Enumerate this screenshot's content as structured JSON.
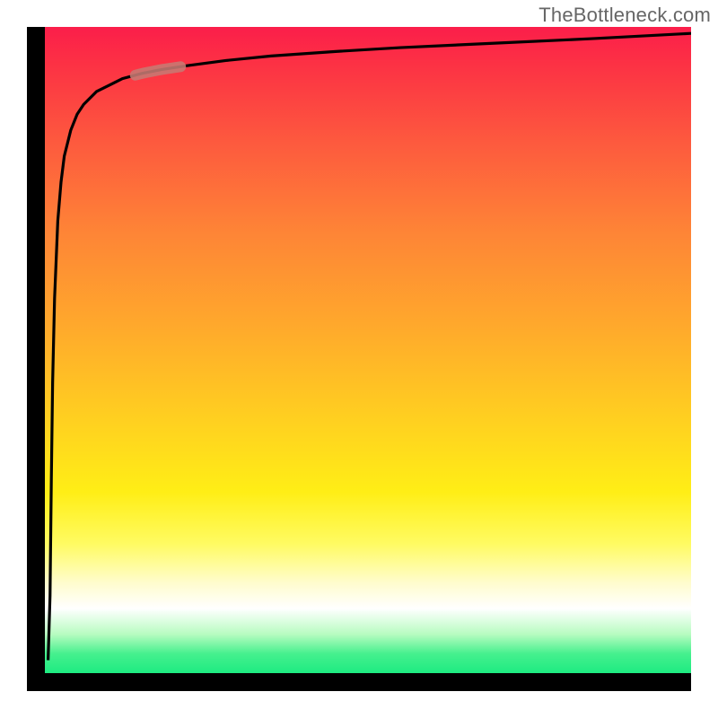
{
  "watermark_text": "TheBottleneck.com",
  "colors": {
    "curve": "#000000",
    "highlight": "#c67a73",
    "frame": "#000000",
    "watermark": "#666666"
  },
  "chart_data": {
    "type": "line",
    "title": "",
    "xlabel": "",
    "ylabel": "",
    "xlim": [
      0,
      100
    ],
    "ylim": [
      0,
      100
    ],
    "grid": false,
    "legend": false,
    "series": [
      {
        "name": "bottleneck-curve",
        "x": [
          0.5,
          0.8,
          1.0,
          1.2,
          1.5,
          2.0,
          2.5,
          3.0,
          4.0,
          5.0,
          6.0,
          8.0,
          10,
          12,
          15,
          18,
          22,
          28,
          35,
          45,
          55,
          70,
          85,
          100
        ],
        "y": [
          2,
          12,
          30,
          45,
          58,
          70,
          76,
          80,
          84,
          86.5,
          88,
          90,
          91,
          92,
          92.8,
          93.4,
          94,
          94.8,
          95.5,
          96.2,
          96.8,
          97.5,
          98.2,
          99
        ]
      }
    ],
    "highlight_segment": {
      "x_start": 14,
      "x_end": 21,
      "note": "short pink-red segment on the upper-left curve knee"
    },
    "background_gradient": {
      "direction": "vertical",
      "stops": [
        {
          "pos": 0.0,
          "color": "#fb1e4a"
        },
        {
          "pos": 0.18,
          "color": "#fd5a3e"
        },
        {
          "pos": 0.46,
          "color": "#ffa82c"
        },
        {
          "pos": 0.72,
          "color": "#ffee16"
        },
        {
          "pos": 0.9,
          "color": "#ffffff"
        },
        {
          "pos": 1.0,
          "color": "#1deb81"
        }
      ]
    }
  }
}
